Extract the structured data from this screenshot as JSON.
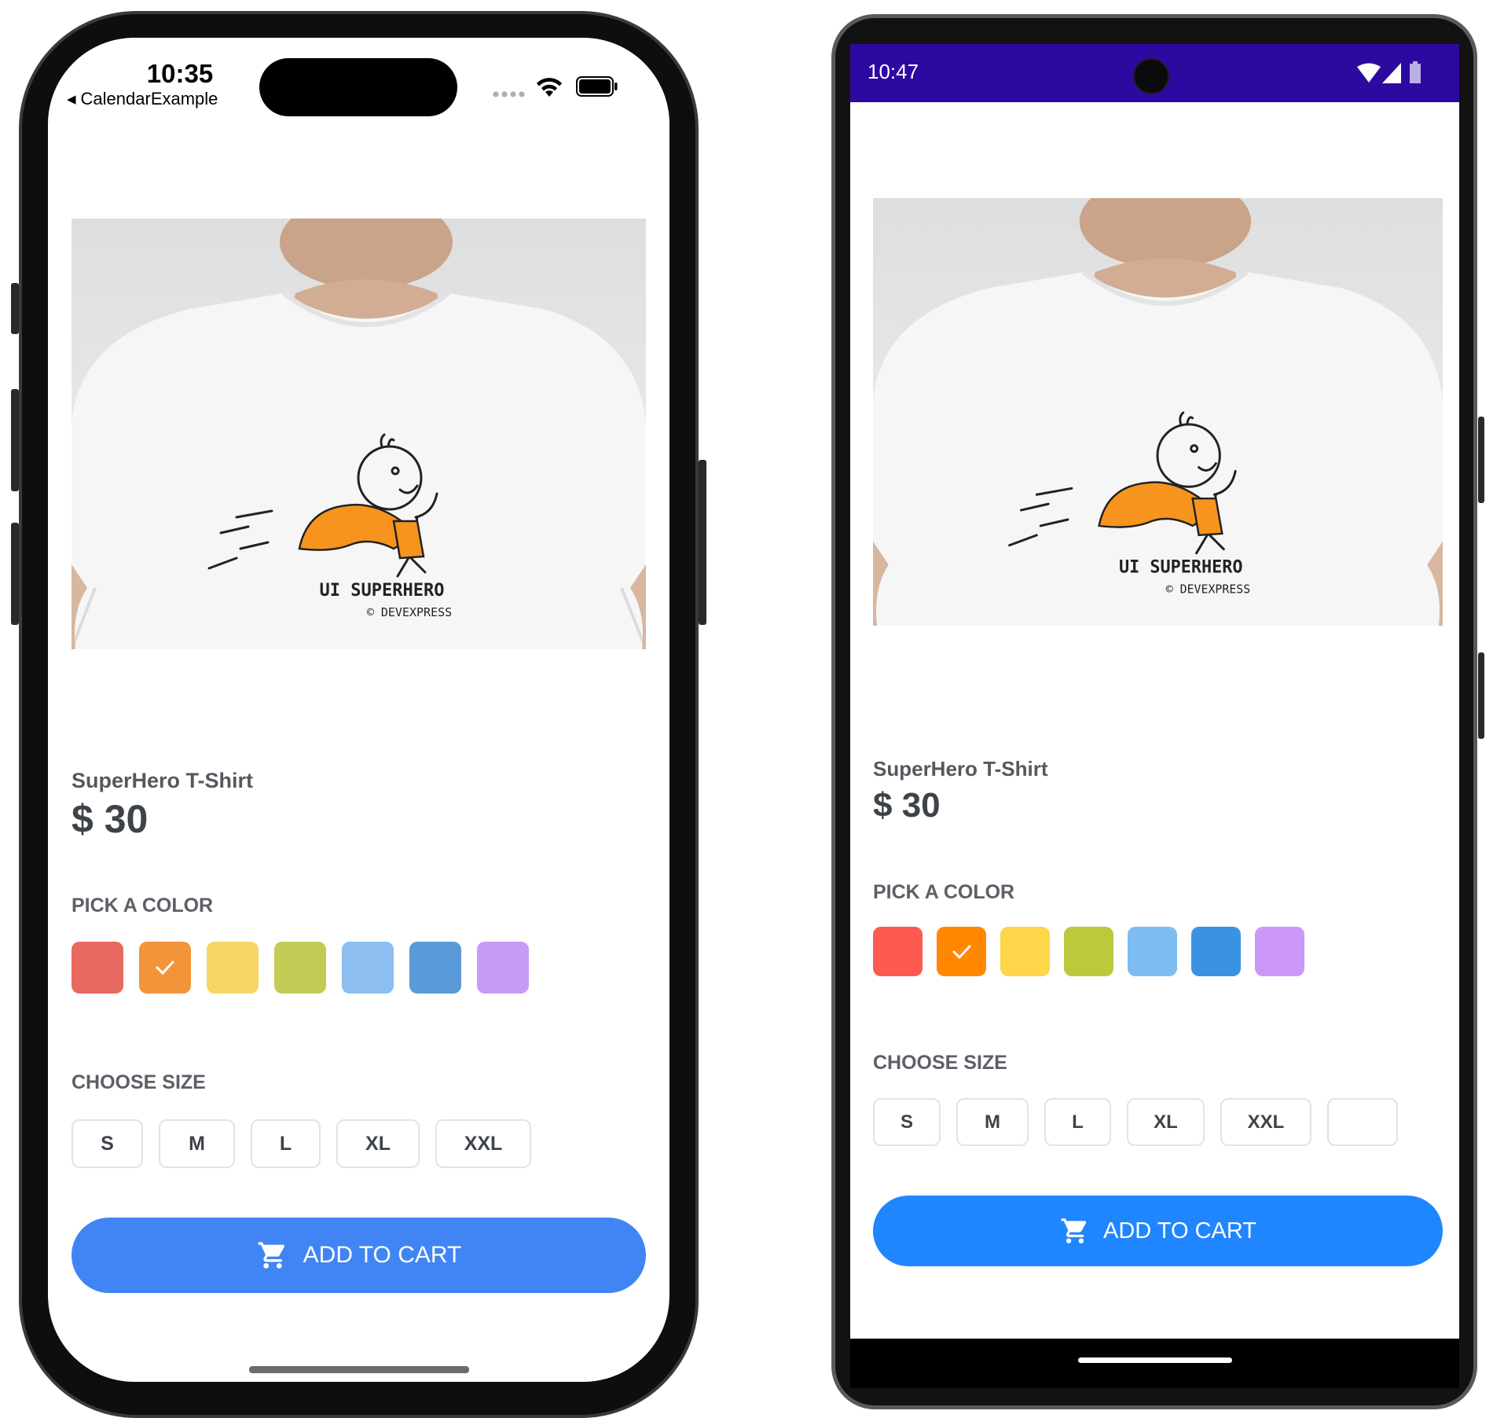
{
  "ios": {
    "status": {
      "time": "10:35",
      "back_label": "CalendarExample",
      "signal_icon": "signal-dots-icon",
      "wifi_icon": "wifi-icon",
      "battery_icon": "battery-icon"
    },
    "product": {
      "name": "SuperHero T-Shirt",
      "price": "$ 30",
      "image_icon": "tshirt-photo"
    },
    "color_section": {
      "label": "PICK A COLOR",
      "selected_index": 1,
      "colors": [
        "#e8695f",
        "#f2953a",
        "#f7d565",
        "#c2cc54",
        "#8cbef0",
        "#5b9ad9",
        "#c69bf8"
      ]
    },
    "size_section": {
      "label": "CHOOSE SIZE",
      "sizes": [
        "S",
        "M",
        "L",
        "XL",
        "XXL"
      ]
    },
    "cart_button": {
      "label": "ADD TO CART",
      "icon": "cart-icon",
      "color": "#4185f4"
    }
  },
  "android": {
    "status": {
      "time": "10:47",
      "status_bar_color": "#2c0aa0",
      "wifi_icon": "wifi-icon",
      "signal_icon": "cell-signal-icon",
      "battery_icon": "battery-icon"
    },
    "product": {
      "name": "SuperHero T-Shirt",
      "price": "$ 30",
      "image_icon": "tshirt-photo"
    },
    "color_section": {
      "label": "PICK A COLOR",
      "selected_index": 1,
      "colors": [
        "#fd5a52",
        "#ff8800",
        "#ffd54a",
        "#bbc93c",
        "#7dbdf2",
        "#3b92e3",
        "#cc96fb"
      ]
    },
    "size_section": {
      "label": "CHOOSE SIZE",
      "sizes": [
        "S",
        "M",
        "L",
        "XL",
        "XXL"
      ]
    },
    "cart_button": {
      "label": "ADD TO CART",
      "icon": "cart-icon",
      "color": "#1f86ff"
    }
  },
  "artwork": {
    "line1": "UI SUPERHERO",
    "line2": "© DEVEXPRESS"
  }
}
